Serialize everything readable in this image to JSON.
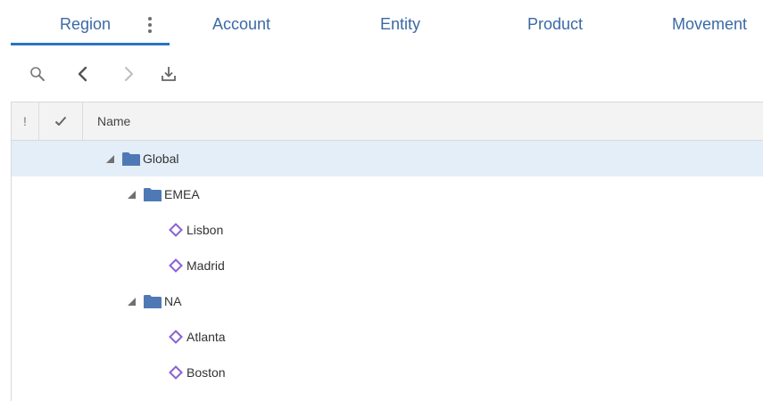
{
  "tabs": [
    {
      "label": "Region",
      "selected": true
    },
    {
      "label": "Account",
      "selected": false
    },
    {
      "label": "Entity",
      "selected": false
    },
    {
      "label": "Product",
      "selected": false
    },
    {
      "label": "Movement",
      "selected": false
    }
  ],
  "toolbar": {
    "icons": [
      "search-icon",
      "previous-icon",
      "next-icon",
      "export-icon"
    ]
  },
  "grid": {
    "headers": {
      "status": "!",
      "check_icon": "checkmark-icon",
      "name": "Name"
    },
    "rows": [
      {
        "label": "Global",
        "type": "folder",
        "expanded": true,
        "selected": true
      },
      {
        "label": "EMEA",
        "type": "folder",
        "expanded": true,
        "selected": false
      },
      {
        "label": "Lisbon",
        "type": "member",
        "selected": false
      },
      {
        "label": "Madrid",
        "type": "member",
        "selected": false
      },
      {
        "label": "NA",
        "type": "folder",
        "expanded": true,
        "selected": false
      },
      {
        "label": "Atlanta",
        "type": "member",
        "selected": false
      },
      {
        "label": "Boston",
        "type": "member",
        "selected": false
      }
    ]
  },
  "colors": {
    "tab_text": "#3a6aa6",
    "tab_underline": "#2d73c4",
    "folder": "#4f79b5",
    "member": "#8a62d2",
    "selected_row": "#e4eef8"
  }
}
